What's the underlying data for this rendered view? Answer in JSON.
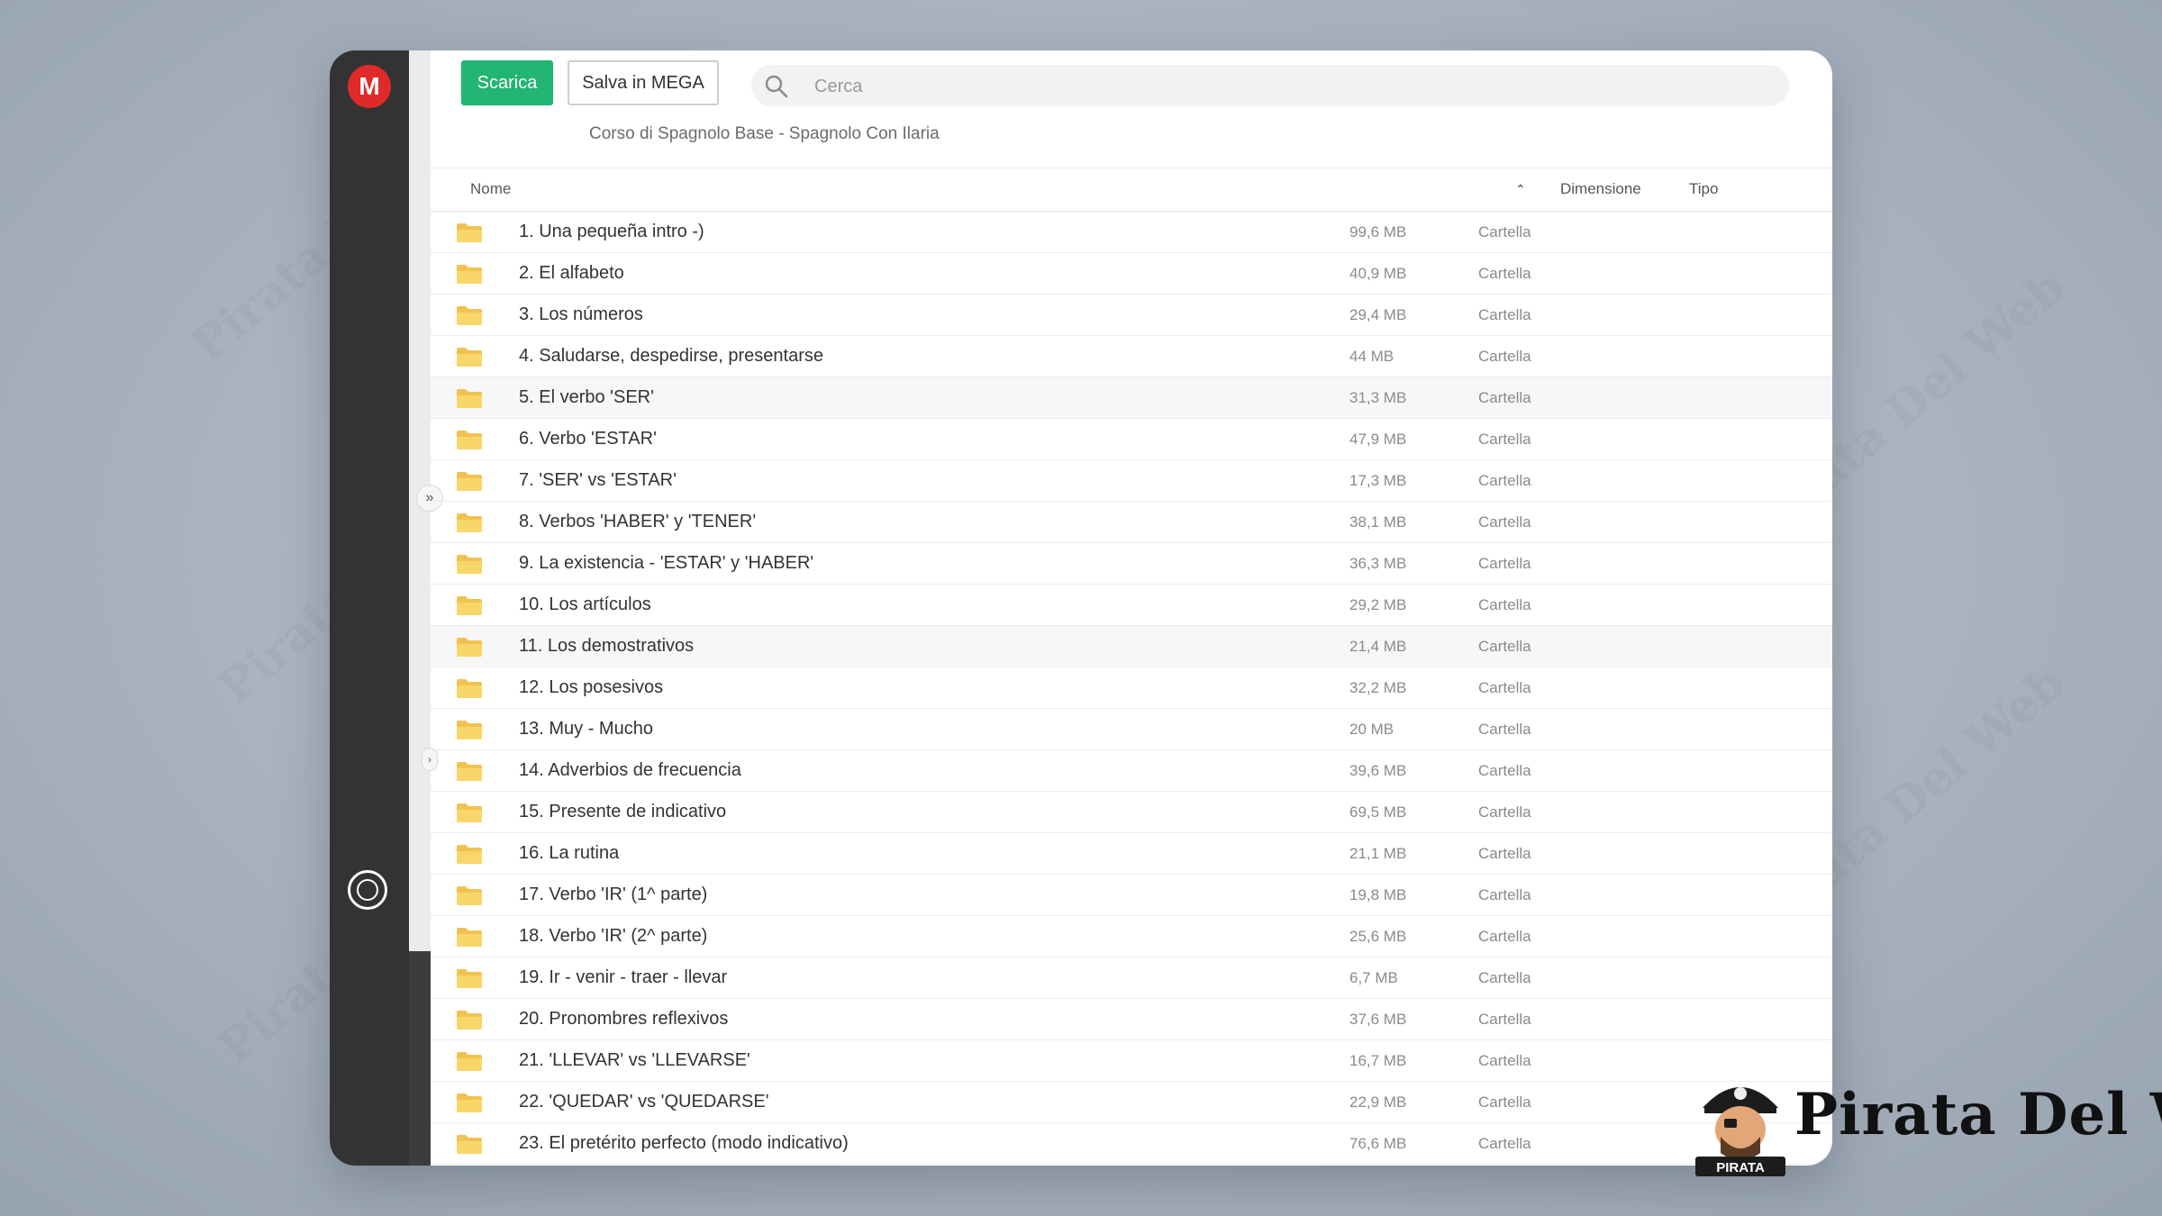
{
  "toolbar": {
    "download_label": "Scarica",
    "save_label": "Salva in MEGA"
  },
  "search": {
    "placeholder": "Cerca"
  },
  "breadcrumb": "Corso di Spagnolo Base - Spagnolo Con Ilaria",
  "table": {
    "headers": {
      "name": "Nome",
      "size": "Dimensione",
      "type": "Tipo"
    },
    "rows": [
      {
        "name": "1. Una pequeña intro -)",
        "size": "99,6 MB",
        "type": "Cartella"
      },
      {
        "name": "2. El alfabeto",
        "size": "40,9 MB",
        "type": "Cartella"
      },
      {
        "name": "3. Los números",
        "size": "29,4 MB",
        "type": "Cartella"
      },
      {
        "name": "4. Saludarse, despedirse, presentarse",
        "size": "44 MB",
        "type": "Cartella"
      },
      {
        "name": "5. El verbo 'SER'",
        "size": "31,3 MB",
        "type": "Cartella"
      },
      {
        "name": "6. Verbo 'ESTAR'",
        "size": "47,9 MB",
        "type": "Cartella"
      },
      {
        "name": "7. 'SER' vs 'ESTAR'",
        "size": "17,3 MB",
        "type": "Cartella"
      },
      {
        "name": "8. Verbos 'HABER' y 'TENER'",
        "size": "38,1 MB",
        "type": "Cartella"
      },
      {
        "name": "9. La existencia - 'ESTAR' y 'HABER'",
        "size": "36,3 MB",
        "type": "Cartella"
      },
      {
        "name": "10. Los artículos",
        "size": "29,2 MB",
        "type": "Cartella"
      },
      {
        "name": "11. Los demostrativos",
        "size": "21,4 MB",
        "type": "Cartella"
      },
      {
        "name": "12. Los posesivos",
        "size": "32,2 MB",
        "type": "Cartella"
      },
      {
        "name": "13. Muy - Mucho",
        "size": "20 MB",
        "type": "Cartella"
      },
      {
        "name": "14. Adverbios de frecuencia",
        "size": "39,6 MB",
        "type": "Cartella"
      },
      {
        "name": "15. Presente de indicativo",
        "size": "69,5 MB",
        "type": "Cartella"
      },
      {
        "name": "16. La rutina",
        "size": "21,1 MB",
        "type": "Cartella"
      },
      {
        "name": "17. Verbo 'IR' (1^ parte)",
        "size": "19,8 MB",
        "type": "Cartella"
      },
      {
        "name": "18. Verbo 'IR' (2^ parte)",
        "size": "25,6 MB",
        "type": "Cartella"
      },
      {
        "name": "19. Ir - venir - traer - llevar",
        "size": "6,7 MB",
        "type": "Cartella"
      },
      {
        "name": "20. Pronombres reflexivos",
        "size": "37,6 MB",
        "type": "Cartella"
      },
      {
        "name": "21. 'LLEVAR' vs 'LLEVARSE'",
        "size": "16,7 MB",
        "type": "Cartella"
      },
      {
        "name": "22. 'QUEDAR' vs 'QUEDARSE'",
        "size": "22,9 MB",
        "type": "Cartella"
      },
      {
        "name": "23. El pretérito perfecto (modo indicativo)",
        "size": "76,6 MB",
        "type": "Cartella"
      }
    ]
  },
  "watermark_text": "Pirata Del Web",
  "brand": {
    "name": "Pirata Del Web",
    "badge": "PIRATA"
  },
  "colors": {
    "accent_green": "#22b573",
    "mega_red": "#e02a2a",
    "folder_yellow": "#f5c752",
    "sidebar": "#333333"
  }
}
